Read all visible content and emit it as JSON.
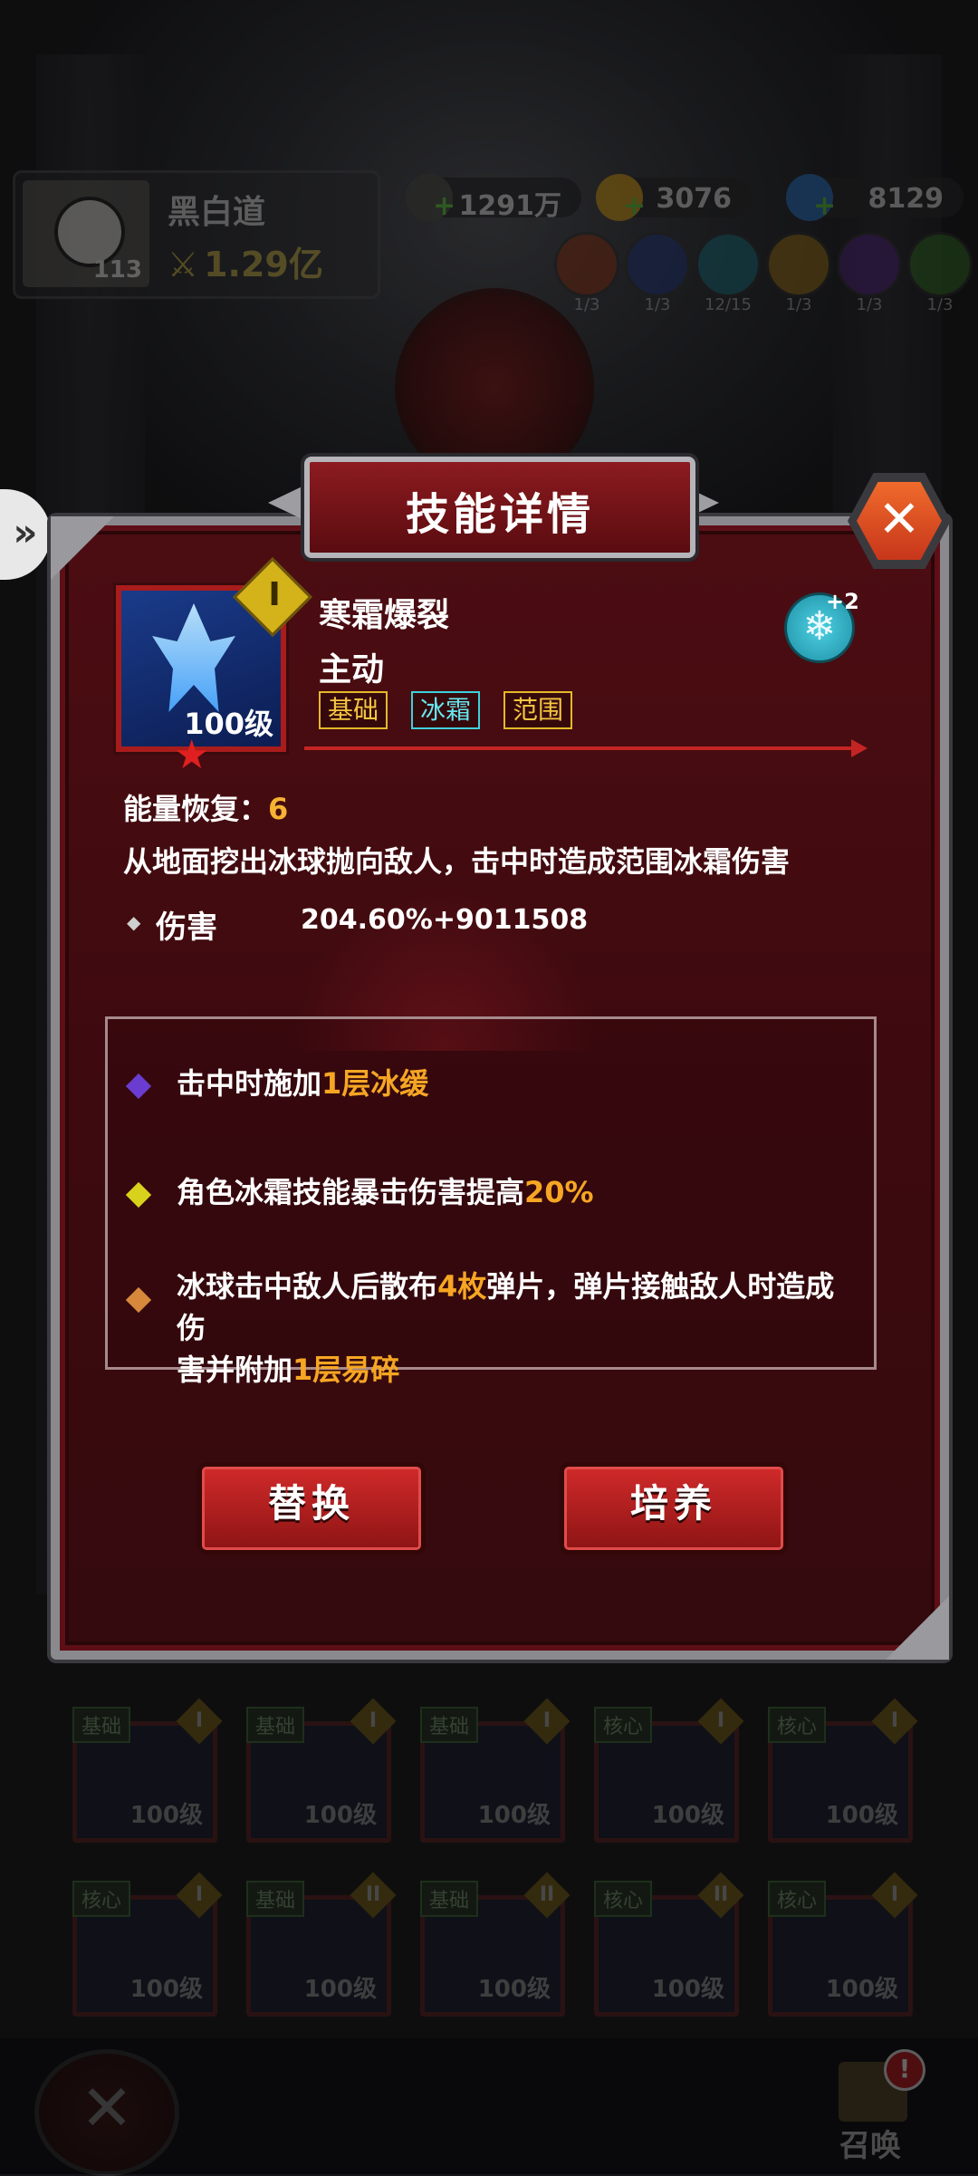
{
  "player": {
    "name": "黑白道",
    "level": "113",
    "power": "1.29亿"
  },
  "resources": [
    {
      "name": "coin-green",
      "value": "1291万",
      "color": "#4a4d44"
    },
    {
      "name": "coin-gold",
      "value": "3076",
      "color": "#c8941c"
    },
    {
      "name": "gem-blue",
      "value": "8129",
      "color": "#2f6fb8"
    }
  ],
  "element_orbs": [
    {
      "icon": "fire-orb-icon",
      "count": "1/3",
      "color": "#9a3a1a"
    },
    {
      "icon": "water-orb-icon",
      "count": "1/3",
      "color": "#2a3f8a"
    },
    {
      "icon": "ice-orb-icon",
      "count": "12/15",
      "color": "#1f7a8a"
    },
    {
      "icon": "light-orb-icon",
      "count": "1/3",
      "color": "#a67a1a"
    },
    {
      "icon": "dark-orb-icon",
      "count": "1/3",
      "color": "#5a2a8a"
    },
    {
      "icon": "nature-orb-icon",
      "count": "1/3",
      "color": "#3a7a2a"
    }
  ],
  "dialog": {
    "title": "技能详情",
    "close_symbol": "✕",
    "skill": {
      "name": "寒霜爆裂",
      "type": "主动",
      "level": "100级",
      "rank": "I",
      "tags": [
        "基础",
        "冰霜",
        "范围"
      ],
      "element_bonus": "+2"
    },
    "energy_label": "能量恢复：",
    "energy_value": "6",
    "description": "从地面挖出冰球抛向敌人，击中时造成范围冰霜伤害",
    "damage_label": "伤害",
    "damage_value": "204.60%+9011508",
    "effects": [
      {
        "gem_color": "#6a3ccf",
        "parts": [
          "击中时施加",
          "1层冰缓",
          ""
        ]
      },
      {
        "gem_color": "#d8d21c",
        "parts": [
          "角色冰霜技能暴击伤害提高",
          "20%",
          ""
        ]
      },
      {
        "gem_color": "#d8883a",
        "parts_multi": [
          "冰球击中敌人后散布",
          "4枚",
          "弹片，弹片接触敌人时造成伤",
          "害并附加",
          "1层易碎"
        ]
      }
    ],
    "buttons": {
      "replace": "替换",
      "cultivate": "培养"
    }
  },
  "skill_grid": [
    {
      "tag": "基础",
      "rank": "I",
      "level": "100级"
    },
    {
      "tag": "基础",
      "rank": "I",
      "level": "100级"
    },
    {
      "tag": "基础",
      "rank": "I",
      "level": "100级"
    },
    {
      "tag": "核心",
      "rank": "I",
      "level": "100级"
    },
    {
      "tag": "核心",
      "rank": "I",
      "level": "100级"
    },
    {
      "tag": "核心",
      "rank": "I",
      "level": "100级"
    },
    {
      "tag": "基础",
      "rank": "II",
      "level": "100级"
    },
    {
      "tag": "基础",
      "rank": "II",
      "level": "100级"
    },
    {
      "tag": "核心",
      "rank": "II",
      "level": "100级"
    },
    {
      "tag": "核心",
      "rank": "I",
      "level": "100级"
    }
  ],
  "partial_row_level": "100级",
  "bottom": {
    "close_symbol": "✕",
    "summon_label": "召唤",
    "summon_alert": "!"
  }
}
